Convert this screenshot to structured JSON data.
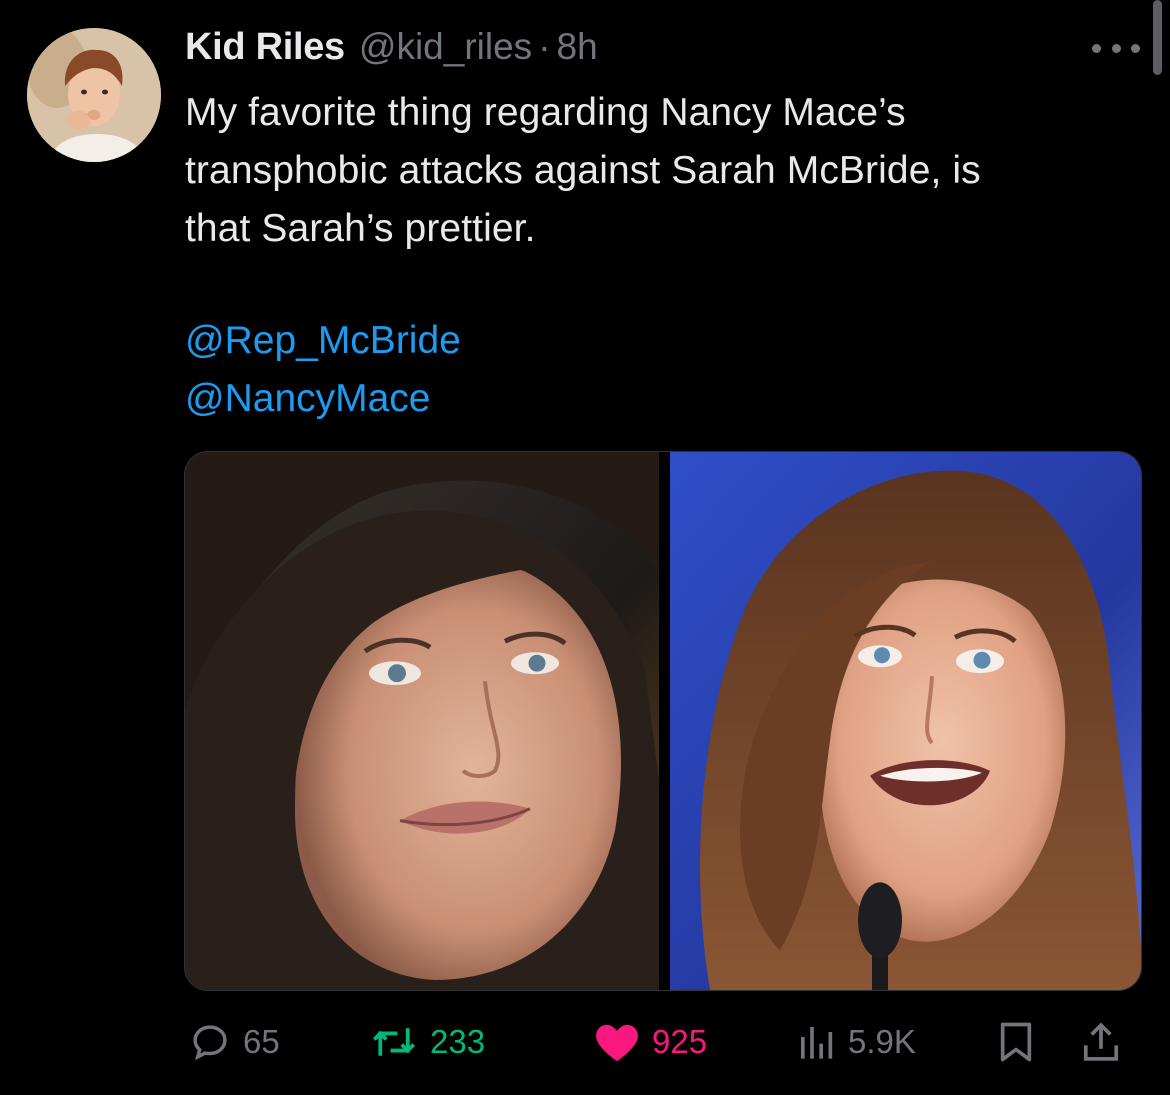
{
  "tweet": {
    "author": {
      "display_name": "Kid Riles",
      "handle": "@kid_riles",
      "separator": "·",
      "time": "8h"
    },
    "text_lines": [
      "My favorite thing regarding Nancy Mace’s",
      "transphobic attacks against Sarah McBride, is",
      "that Sarah’s prettier."
    ],
    "mentions": [
      "@Rep_McBride",
      "@NancyMace"
    ],
    "media_count": 2,
    "stats": {
      "replies": "65",
      "reposts": "233",
      "likes": "925",
      "views": "5.9K"
    },
    "liked": true
  },
  "colors": {
    "background": "#000000",
    "text": "#e7e9ea",
    "muted": "#71767b",
    "link": "#1d9bf0",
    "repost": "#00ba7c",
    "like": "#f91880"
  },
  "icons": {
    "more": "more-horizontal-icon",
    "reply": "reply-bubble-icon",
    "repost": "repost-arrows-icon",
    "like": "heart-filled-icon",
    "views": "views-bar-chart-icon",
    "bookmark": "bookmark-icon",
    "share": "share-upload-icon"
  }
}
